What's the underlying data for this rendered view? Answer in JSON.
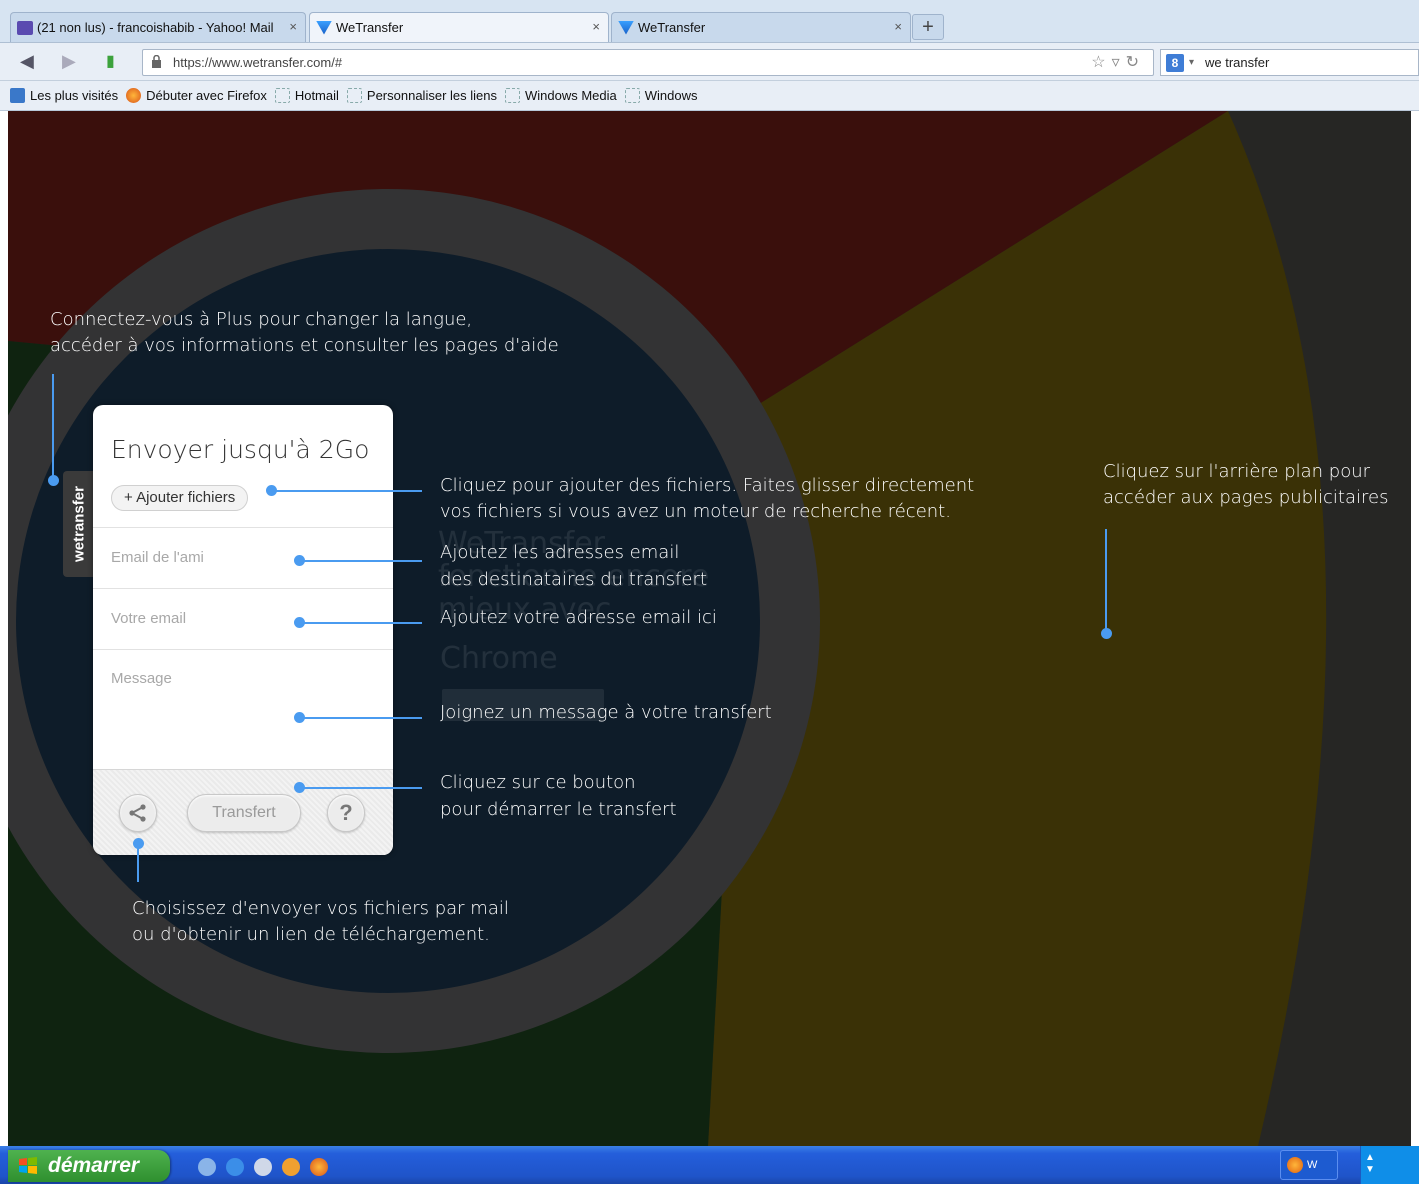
{
  "browser": {
    "tabs": [
      {
        "label": "(21 non lus) - francoishabib - Yahoo! Mail",
        "active": false
      },
      {
        "label": "WeTransfer",
        "active": true
      },
      {
        "label": "WeTransfer",
        "active": false
      }
    ],
    "new_tab_label": "+",
    "url": "https://www.wetransfer.com/#",
    "search_query": "we transfer",
    "search_engine_label": "8",
    "bookmarks": [
      "Les plus visités",
      "Débuter avec Firefox",
      "Hotmail",
      "Personnaliser les liens",
      "Windows Media",
      "Windows"
    ]
  },
  "panel": {
    "side_tab_label": "wetransfer",
    "title": "Envoyer jusqu'à 2Go",
    "add_files_label": "+ Ajouter fichiers",
    "friend_email_placeholder": "Email de l'ami",
    "your_email_placeholder": "Votre email",
    "message_placeholder": "Message",
    "transfer_button_label": "Transfert",
    "help_button_label": "?"
  },
  "annotations": {
    "login_line1": "Connectez-vous à Plus pour changer la langue,",
    "login_line2": "accéder à vos informations et consulter les pages d'aide",
    "add_files_line1": "Cliquez pour ajouter des fichiers. Faites glisser directement",
    "add_files_line2": "vos fichiers si vous avez un moteur de recherche récent.",
    "recipients_line1": "Ajoutez les adresses email",
    "recipients_line2": "des destinataires du transfert",
    "your_email": "Ajoutez votre adresse email ici",
    "message": "Joignez un message à votre transfert",
    "transfer_line1": "Cliquez sur ce bouton",
    "transfer_line2": "pour démarrer le transfert",
    "share_line1": "Choisissez d'envoyer vos fichiers par mail",
    "share_line2": "ou d'obtenir un lien de téléchargement.",
    "background_line1": "Cliquez sur l'arrière plan pour",
    "background_line2": "accéder aux pages publicitaires"
  },
  "background_ad": {
    "line1": "WeTransfer",
    "line2": "fonctionne encore",
    "line3": "mieux avec",
    "line4": "Chrome"
  },
  "taskbar": {
    "start_label": "démarrer",
    "tray_label": "W"
  },
  "colors": {
    "accent": "#4a9bf0",
    "chrome_red": "#8a1a12",
    "chrome_green": "#1d5a1d",
    "chrome_yellow": "#a88a08",
    "chrome_center": "#1c4a7a"
  }
}
